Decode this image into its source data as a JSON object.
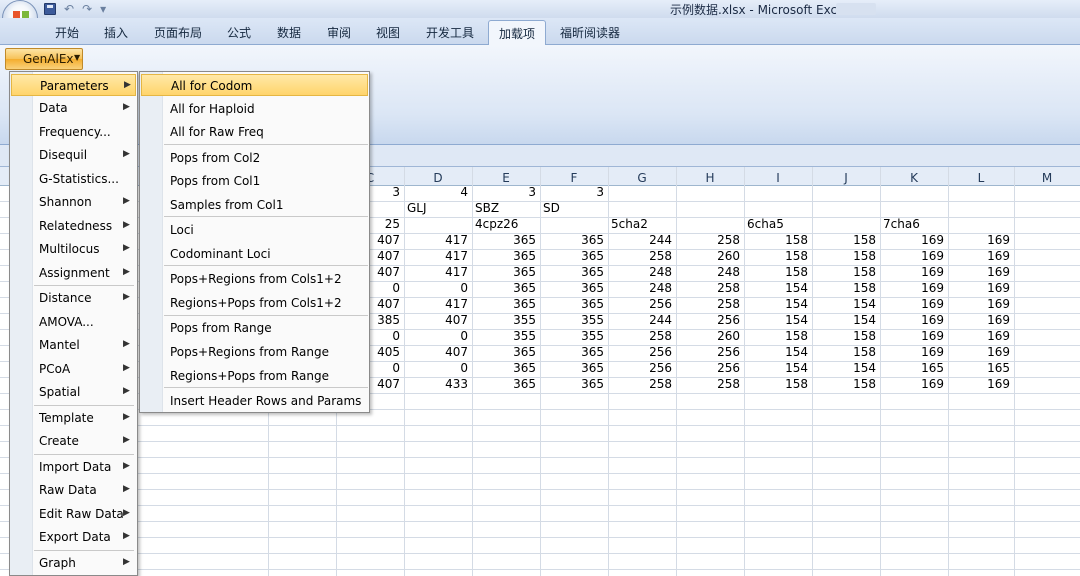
{
  "window": {
    "title": "示例数据.xlsx - Microsoft Excel"
  },
  "qat": [
    "↶",
    "↷",
    "▾"
  ],
  "tabs": [
    {
      "label": "开始",
      "active": false
    },
    {
      "label": "插入",
      "active": false
    },
    {
      "label": "页面布局",
      "active": false
    },
    {
      "label": "公式",
      "active": false
    },
    {
      "label": "数据",
      "active": false
    },
    {
      "label": "审阅",
      "active": false
    },
    {
      "label": "视图",
      "active": false
    },
    {
      "label": "开发工具",
      "active": false
    },
    {
      "label": "加载项",
      "active": true
    },
    {
      "label": "福昕阅读器",
      "active": false
    }
  ],
  "genalex": {
    "label": "GenAlEx"
  },
  "main_menu": [
    {
      "label": "Parameters",
      "submenu": true,
      "highlighted": true
    },
    {
      "label": "Data",
      "submenu": true
    },
    {
      "label": "Frequency...",
      "submenu": false
    },
    {
      "label": "Disequil",
      "submenu": true
    },
    {
      "label": "G-Statistics...",
      "submenu": false
    },
    {
      "label": "Shannon",
      "submenu": true
    },
    {
      "label": "Relatedness",
      "submenu": true
    },
    {
      "label": "Multilocus",
      "submenu": true
    },
    {
      "label": "Assignment",
      "submenu": true
    },
    {
      "label": "Distance",
      "submenu": true
    },
    {
      "label": "AMOVA...",
      "submenu": false
    },
    {
      "label": "Mantel",
      "submenu": true
    },
    {
      "label": "PCoA",
      "submenu": true
    },
    {
      "label": "Spatial",
      "submenu": true
    },
    {
      "label": "Template",
      "submenu": true
    },
    {
      "label": "Create",
      "submenu": true
    },
    {
      "label": "Import Data",
      "submenu": true
    },
    {
      "label": "Raw Data",
      "submenu": true
    },
    {
      "label": "Edit Raw Data",
      "submenu": true
    },
    {
      "label": "Export Data",
      "submenu": true
    },
    {
      "label": "Graph",
      "submenu": true
    }
  ],
  "parameters_submenu": [
    {
      "label": "All for Codom",
      "highlighted": true
    },
    {
      "label": "All for Haploid"
    },
    {
      "label": "All for Raw Freq"
    },
    {
      "label": "Pops from Col2"
    },
    {
      "label": "Pops from Col1"
    },
    {
      "label": "Samples from Col1"
    },
    {
      "label": "Loci"
    },
    {
      "label": "Codominant Loci"
    },
    {
      "label": "Pops+Regions from Cols1+2"
    },
    {
      "label": "Regions+Pops from Cols1+2"
    },
    {
      "label": "Pops from Range"
    },
    {
      "label": "Pops+Regions from Range"
    },
    {
      "label": "Regions+Pops from Range"
    },
    {
      "label": "Insert Header Rows and Params"
    }
  ],
  "sheet": {
    "column_headers": [
      "C",
      "D",
      "E",
      "F",
      "G",
      "H",
      "I",
      "J",
      "K",
      "L",
      "M"
    ],
    "rows": [
      [
        "3",
        "4",
        "3",
        "3",
        "",
        "",
        "",
        "",
        "",
        "",
        ""
      ],
      [
        "",
        "GLJ",
        "SBZ",
        "SD",
        "",
        "",
        "",
        "",
        "",
        "",
        ""
      ],
      [
        "25",
        "",
        "4cpz26",
        "",
        "5cha2",
        "",
        "6cha5",
        "",
        "7cha6",
        "",
        ""
      ],
      [
        "407",
        "417",
        "365",
        "365",
        "244",
        "258",
        "158",
        "158",
        "169",
        "169",
        ""
      ],
      [
        "407",
        "417",
        "365",
        "365",
        "258",
        "260",
        "158",
        "158",
        "169",
        "169",
        ""
      ],
      [
        "407",
        "417",
        "365",
        "365",
        "248",
        "248",
        "158",
        "158",
        "169",
        "169",
        ""
      ],
      [
        "0",
        "0",
        "365",
        "365",
        "248",
        "258",
        "154",
        "158",
        "169",
        "169",
        ""
      ],
      [
        "407",
        "417",
        "365",
        "365",
        "256",
        "258",
        "154",
        "154",
        "169",
        "169",
        ""
      ],
      [
        "385",
        "407",
        "355",
        "355",
        "244",
        "256",
        "154",
        "154",
        "169",
        "169",
        ""
      ],
      [
        "0",
        "0",
        "355",
        "355",
        "258",
        "260",
        "158",
        "158",
        "169",
        "169",
        ""
      ],
      [
        "405",
        "407",
        "365",
        "365",
        "256",
        "256",
        "154",
        "158",
        "169",
        "169",
        ""
      ],
      [
        "0",
        "0",
        "365",
        "365",
        "256",
        "256",
        "154",
        "154",
        "165",
        "165",
        ""
      ],
      [
        "407",
        "433",
        "365",
        "365",
        "258",
        "258",
        "158",
        "158",
        "169",
        "169",
        ""
      ]
    ]
  }
}
